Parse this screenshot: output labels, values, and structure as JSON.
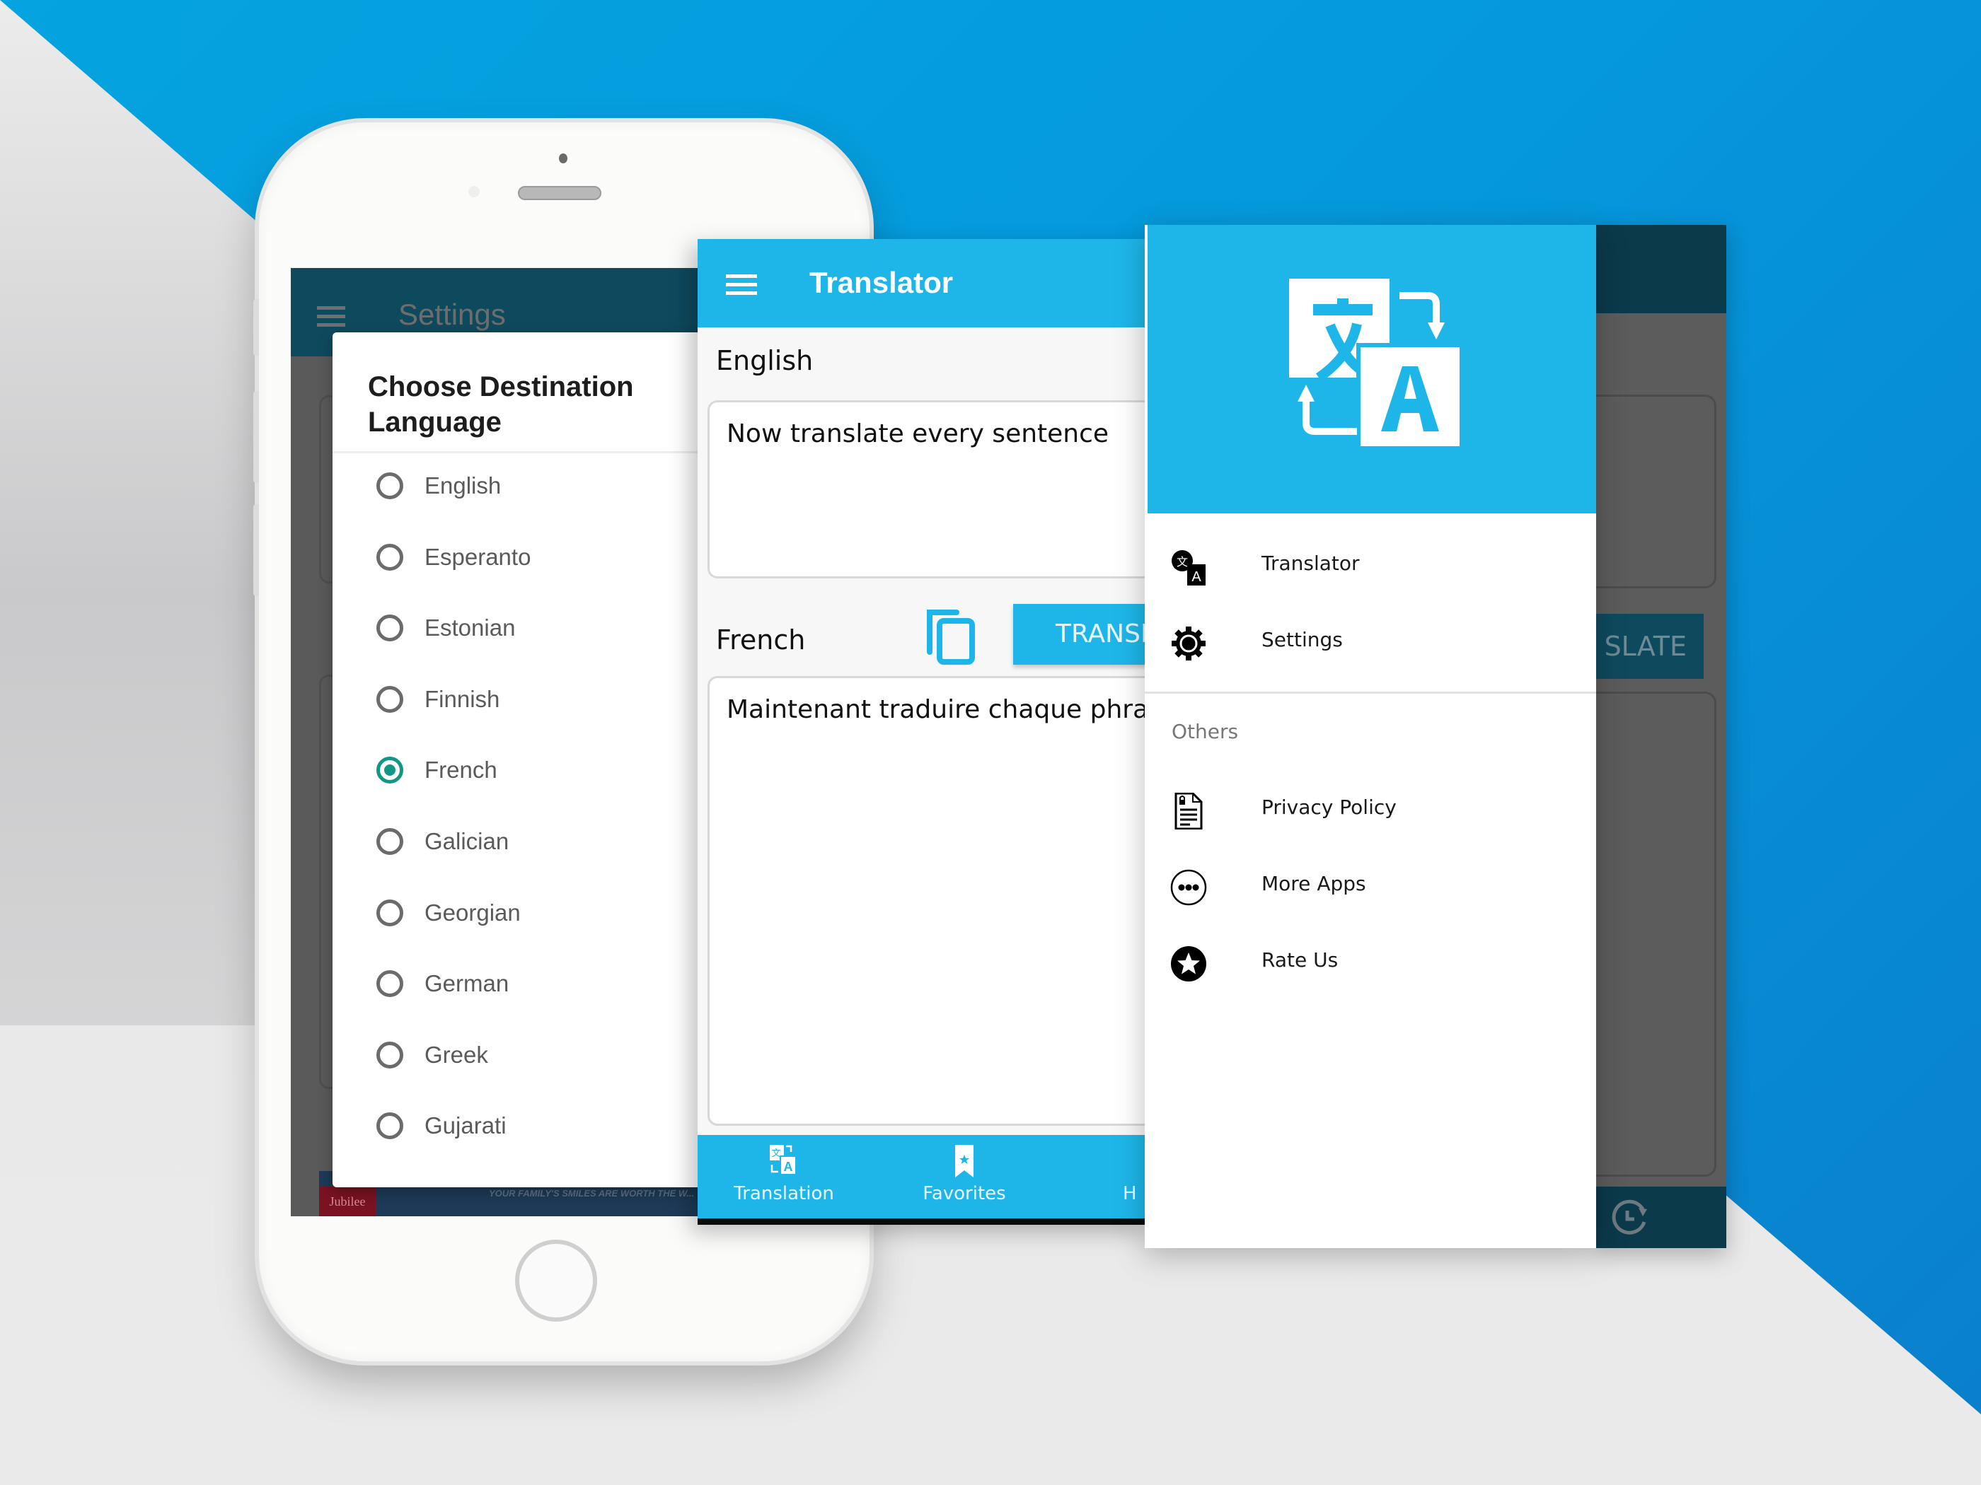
{
  "background": {
    "primary_color": "#0599dc",
    "secondary_color": "#e6e6e6"
  },
  "settings_screen": {
    "title": "Settings",
    "toolbar_color": "#0e4a5e",
    "ad_banner": {
      "brand": "Jubilee",
      "text": "YOUR FAMILY'S SMILES ARE WORTH THE W..."
    }
  },
  "language_dialog": {
    "title": "Choose Destination Language",
    "accent_color": "#129686",
    "selected": "French",
    "options": [
      {
        "label": "English",
        "checked": false
      },
      {
        "label": "Esperanto",
        "checked": false
      },
      {
        "label": "Estonian",
        "checked": false
      },
      {
        "label": "Finnish",
        "checked": false
      },
      {
        "label": "French",
        "checked": true
      },
      {
        "label": "Galician",
        "checked": false
      },
      {
        "label": "Georgian",
        "checked": false
      },
      {
        "label": "German",
        "checked": false
      },
      {
        "label": "Greek",
        "checked": false
      },
      {
        "label": "Gujarati",
        "checked": false
      }
    ]
  },
  "translator_screen": {
    "title": "Translator",
    "accent_color": "#1eb6e8",
    "source_language": "English",
    "source_text": "Now translate every sentence",
    "target_language": "French",
    "translate_button": "TRANSL",
    "output_text": "Maintenant traduire chaque phrase",
    "bottom_nav": [
      {
        "label": "Translation",
        "icon": "translate-icon"
      },
      {
        "label": "Favorites",
        "icon": "bookmark-star-icon"
      },
      {
        "label": "H",
        "icon": "history-icon"
      }
    ]
  },
  "drawer": {
    "header_icon": "translate-logo-icon",
    "items": [
      {
        "label": "Translator",
        "icon": "translate-icon"
      },
      {
        "label": "Settings",
        "icon": "gear-icon"
      }
    ],
    "section_title": "Others",
    "other_items": [
      {
        "label": "Privacy Policy",
        "icon": "document-lock-icon"
      },
      {
        "label": "More Apps",
        "icon": "more-dots-icon"
      },
      {
        "label": "Rate Us",
        "icon": "star-icon"
      }
    ]
  },
  "background_screen": {
    "translate_button_partial": "SLATE",
    "history_icon": "history-icon"
  }
}
